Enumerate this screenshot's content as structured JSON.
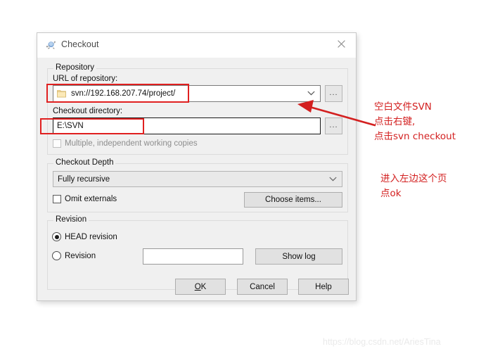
{
  "window": {
    "title": "Checkout",
    "icon": "tortoise-svn-icon",
    "close_label": "✕"
  },
  "repository": {
    "group_title": "Repository",
    "url_label": "URL of repository:",
    "url_value": "svn://192.168.207.74/project/",
    "url_browse_label": "...",
    "dir_label": "Checkout directory:",
    "dir_value": "E:\\SVN",
    "dir_browse_label": "...",
    "multiple_label": "Multiple, independent working copies",
    "multiple_checked": false,
    "multiple_disabled": true
  },
  "checkout_depth": {
    "group_title": "Checkout Depth",
    "depth_value": "Fully recursive",
    "omit_externals_label": "Omit externals",
    "omit_externals_checked": false,
    "choose_items_label": "Choose items..."
  },
  "revision": {
    "group_title": "Revision",
    "head_label": "HEAD revision",
    "head_selected": true,
    "revision_label": "Revision",
    "revision_selected": false,
    "revision_value": "",
    "revision_placeholder": "",
    "show_log_label": "Show log"
  },
  "footer": {
    "ok_label_prefix": "",
    "ok_accel": "O",
    "ok_label_suffix": "K",
    "cancel_label": "Cancel",
    "help_label": "Help"
  },
  "annotations": {
    "note1": "空白文件SVN\n点击右键,\n点击svn checkout",
    "note2": "进入左边这个页\n点ok",
    "color": "#d32020"
  },
  "watermark": {
    "text": "https://blog.csdn.net/AriesTina"
  }
}
